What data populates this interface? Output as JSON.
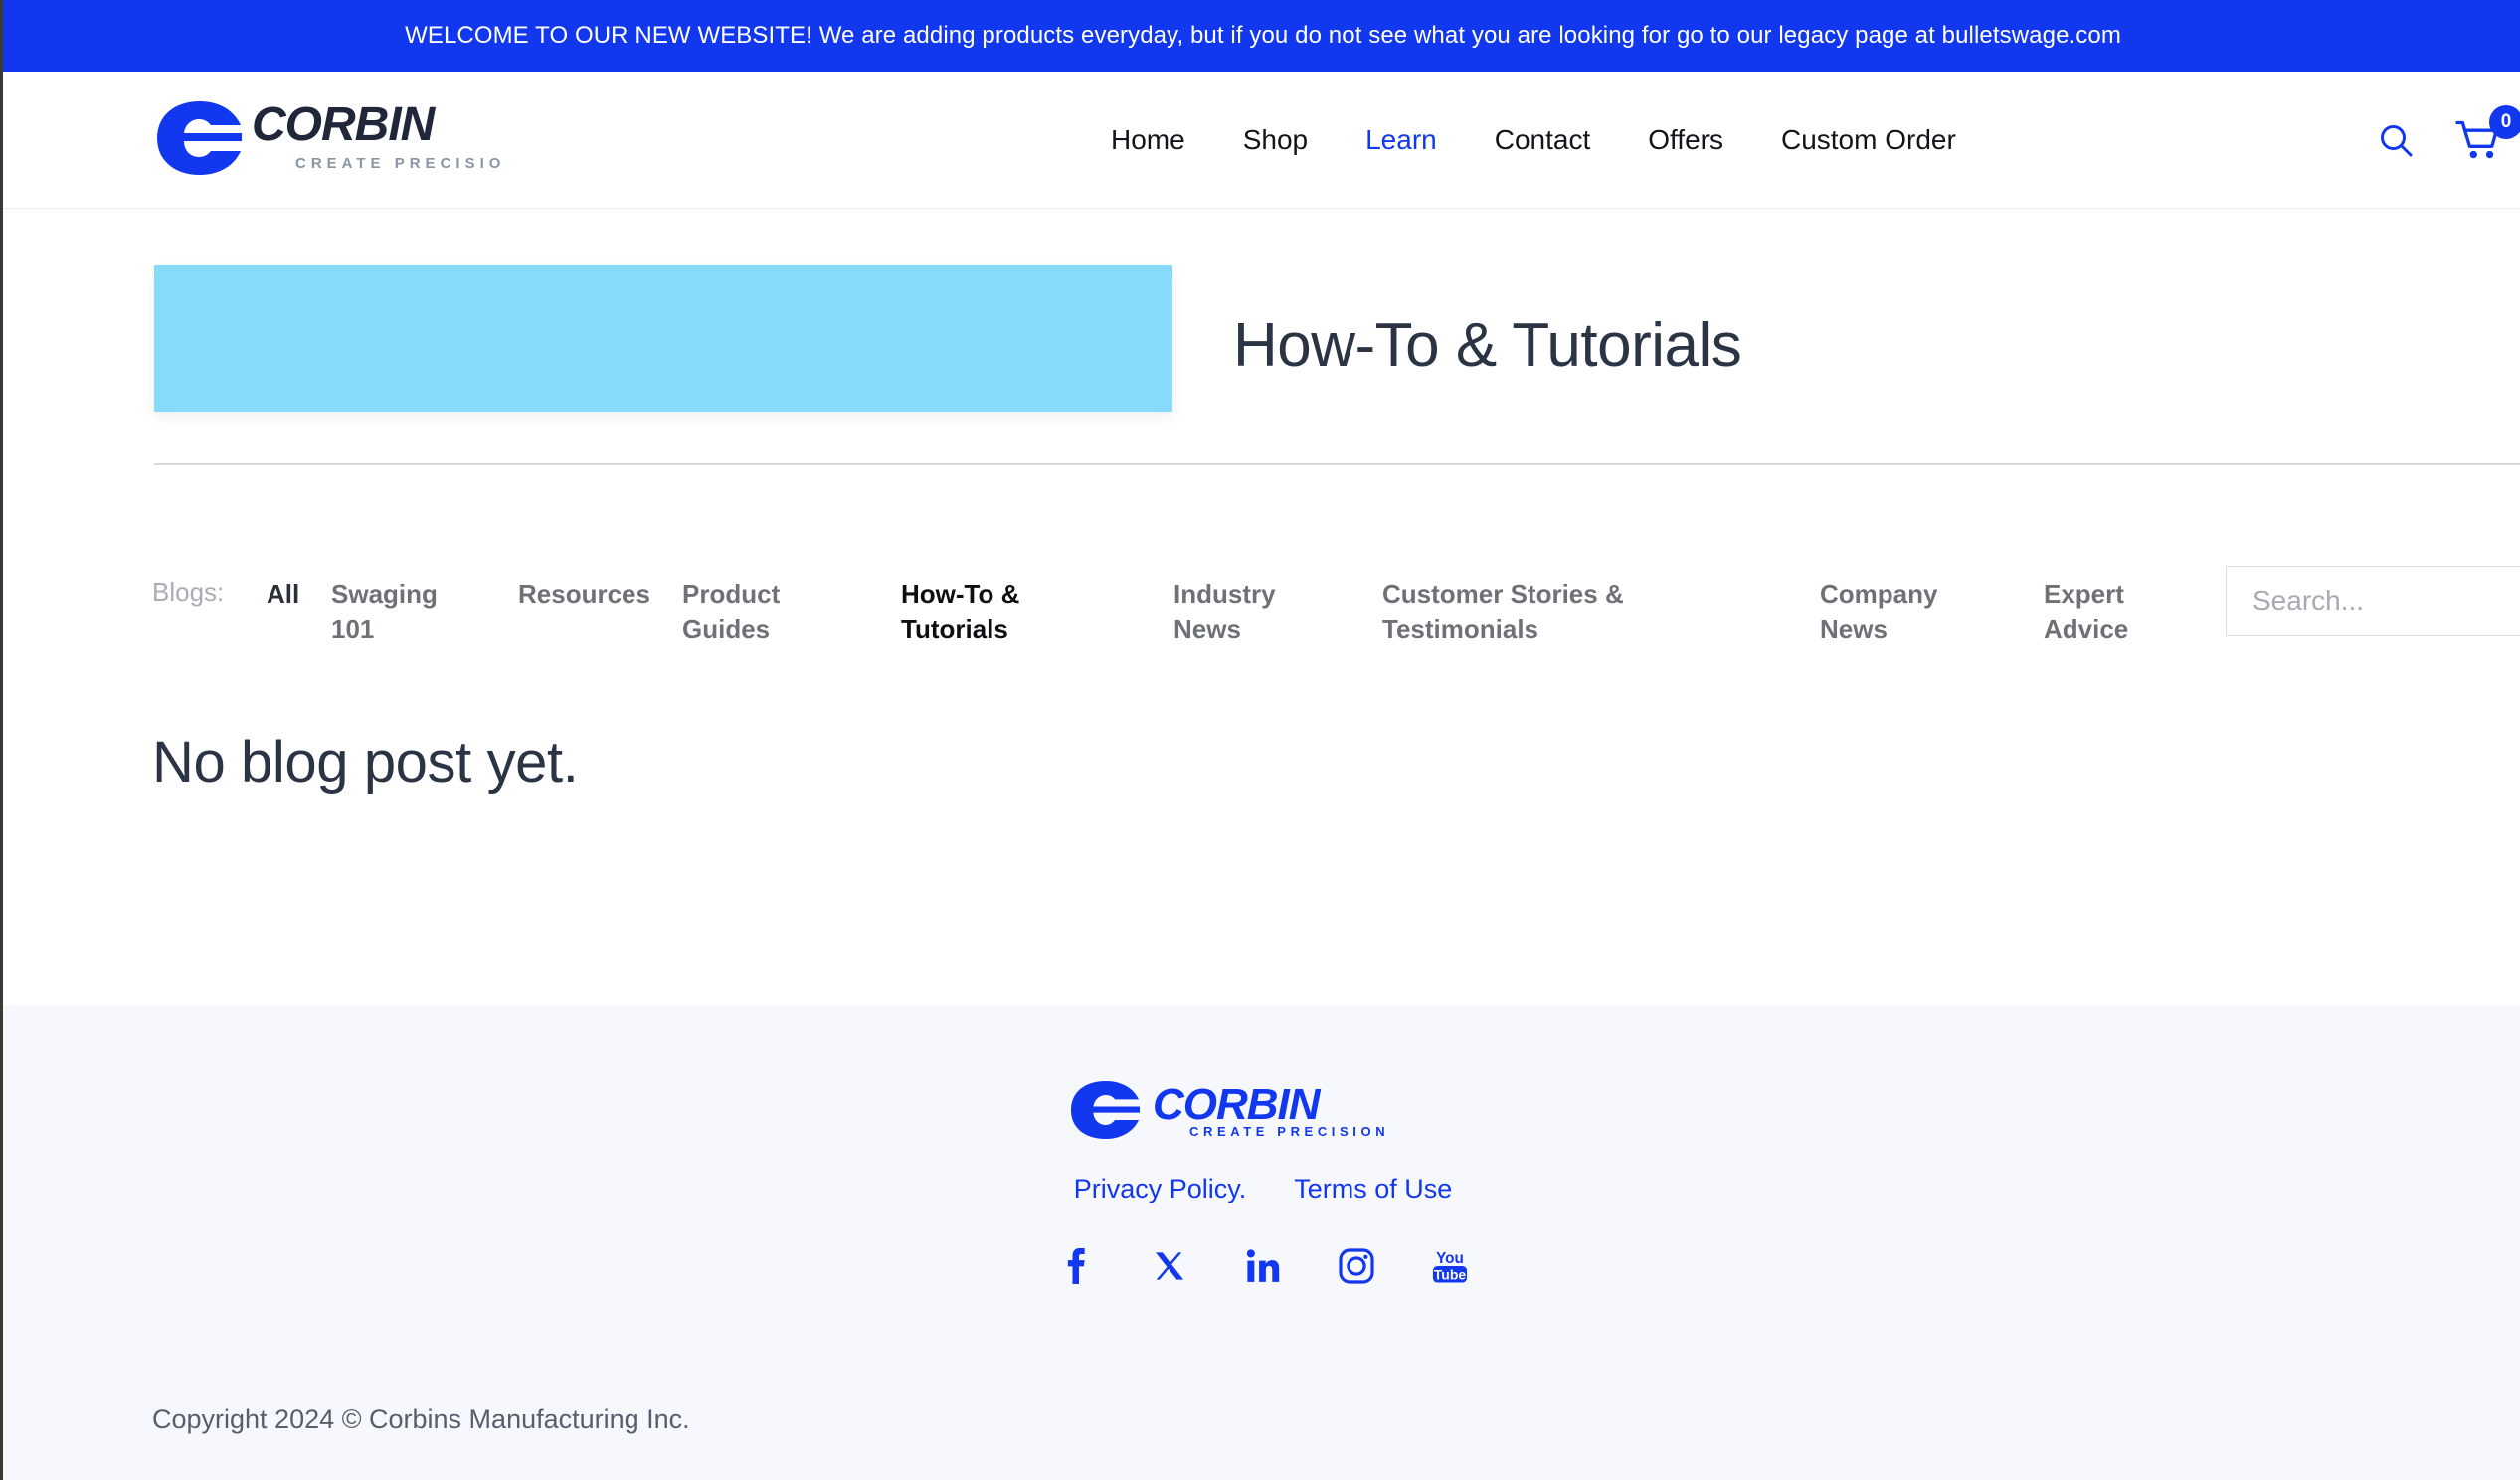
{
  "announcement": {
    "text": "WELCOME TO OUR NEW WEBSITE! We are adding products everyday, but if you do not see what you are looking for go to our legacy page at bulletswage.com",
    "background_color": "#1138EE",
    "text_color": "#FFFFFF"
  },
  "brand": {
    "name": "CORBIN",
    "tagline": "CREATE PRECISION",
    "logo_mark_color": "#1138EE",
    "wordmark_color": "#20273B",
    "tagline_color": "#8A95A5",
    "footer_logo_color": "#1138EE"
  },
  "header": {
    "nav": [
      {
        "label": "Home",
        "active": false
      },
      {
        "label": "Shop",
        "active": false
      },
      {
        "label": "Learn",
        "active": true
      },
      {
        "label": "Contact",
        "active": false
      },
      {
        "label": "Offers",
        "active": false
      },
      {
        "label": "Custom Order",
        "active": false
      }
    ],
    "accent_color": "#1138EE",
    "search_icon": "search-icon",
    "cart_icon": "shopping-cart-icon",
    "cart_count": "0"
  },
  "hero": {
    "title": "How-To & Tutorials",
    "thumbnail_color": "#88DAFB",
    "thumbnail_alt": "blog-category-banner-image"
  },
  "blog_filter": {
    "label": "Blogs:",
    "categories": [
      {
        "label": "All",
        "state": "all"
      },
      {
        "label": "Swaging 101",
        "state": "normal"
      },
      {
        "label": "Resources",
        "state": "normal"
      },
      {
        "label": "Product Guides",
        "state": "normal"
      },
      {
        "label": "How-To & Tutorials",
        "state": "active"
      },
      {
        "label": "Industry News",
        "state": "normal"
      },
      {
        "label": "Customer Stories & Testimonials",
        "state": "normal"
      },
      {
        "label": "Company News",
        "state": "normal"
      },
      {
        "label": "Expert Advice",
        "state": "normal"
      }
    ],
    "search_placeholder": "Search...",
    "search_value": ""
  },
  "main": {
    "empty_message": "No blog post yet."
  },
  "footer": {
    "links": [
      {
        "label": "Privacy Policy."
      },
      {
        "label": "Terms of Use"
      }
    ],
    "social": [
      {
        "name": "facebook-icon",
        "label": "Facebook"
      },
      {
        "name": "x-twitter-icon",
        "label": "X"
      },
      {
        "name": "linkedin-icon",
        "label": "LinkedIn"
      },
      {
        "name": "instagram-icon",
        "label": "Instagram"
      },
      {
        "name": "youtube-icon",
        "label": "YouTube"
      }
    ],
    "copyright": "Copyright 2024 © Corbins Manufacturing Inc.",
    "background_color": "#F6F8FD",
    "link_color": "#1138EE"
  }
}
